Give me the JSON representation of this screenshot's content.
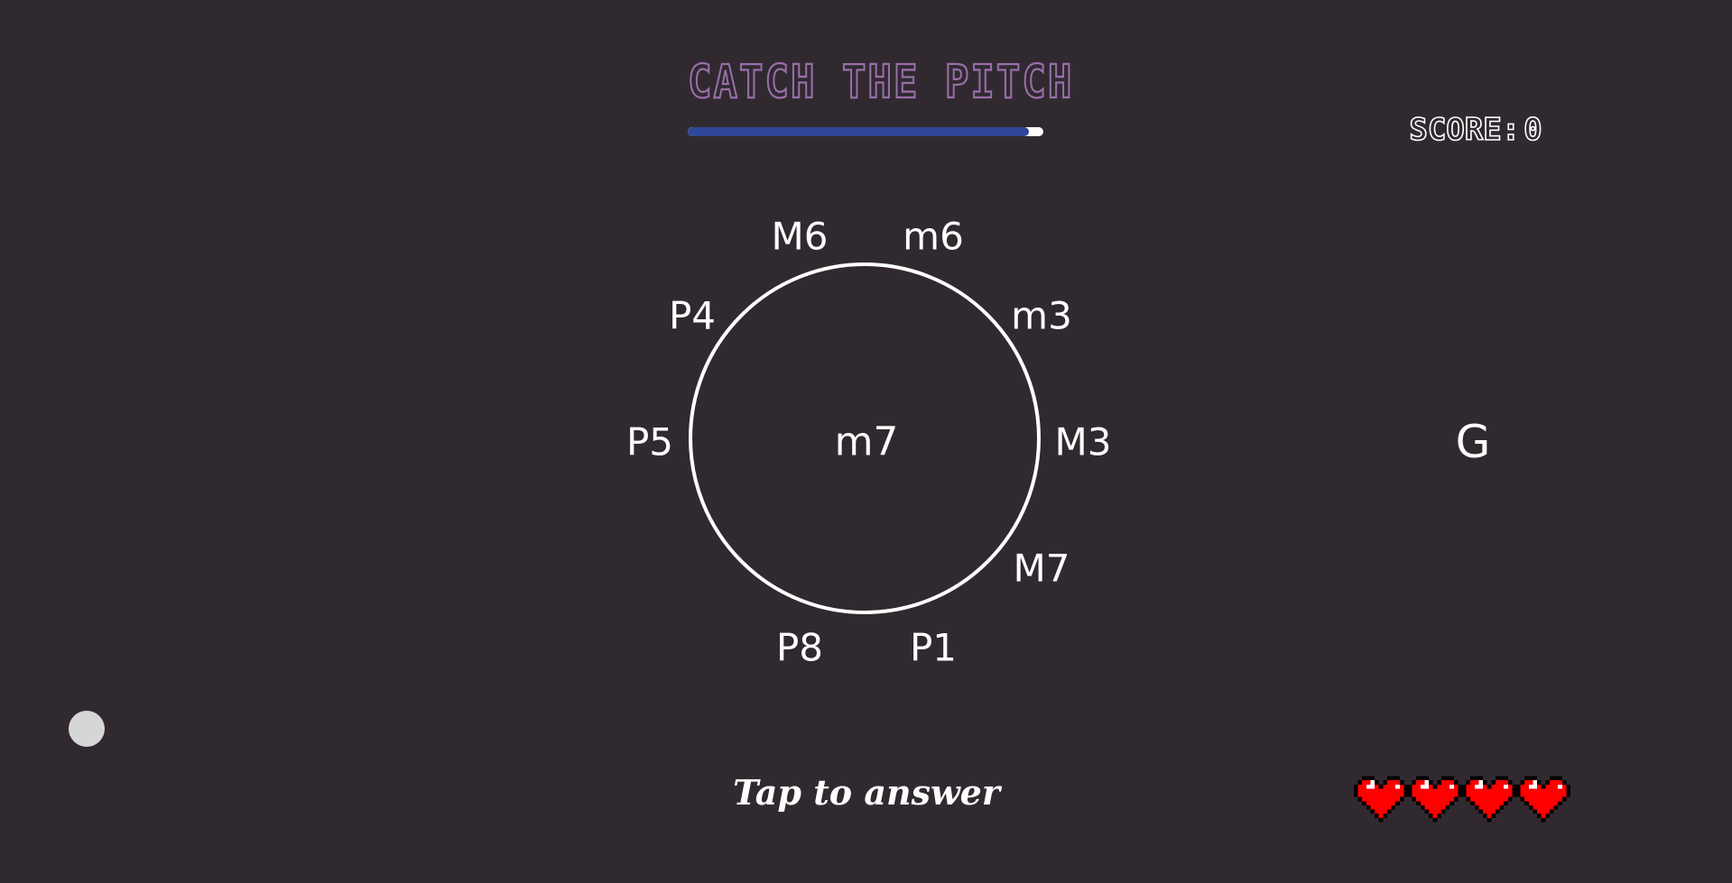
{
  "header": {
    "title": "CATCH THE PITCH",
    "timer_progress": 0.96
  },
  "score": {
    "label": "SCORE:",
    "value": "0"
  },
  "wheel": {
    "center_label": "m7",
    "intervals": [
      "M6",
      "m6",
      "m3",
      "M3",
      "M7",
      "P1",
      "P8",
      "P5",
      "P4"
    ]
  },
  "root_note": "G",
  "prompt": "Tap to answer",
  "lives": {
    "count": 4,
    "icon": "pixel-heart-icon",
    "color": "#ff0000"
  },
  "colors": {
    "background": "#302a30",
    "title_accent": "#9a6fa8",
    "timer_fill": "#2f4797",
    "text": "#ffffff"
  }
}
